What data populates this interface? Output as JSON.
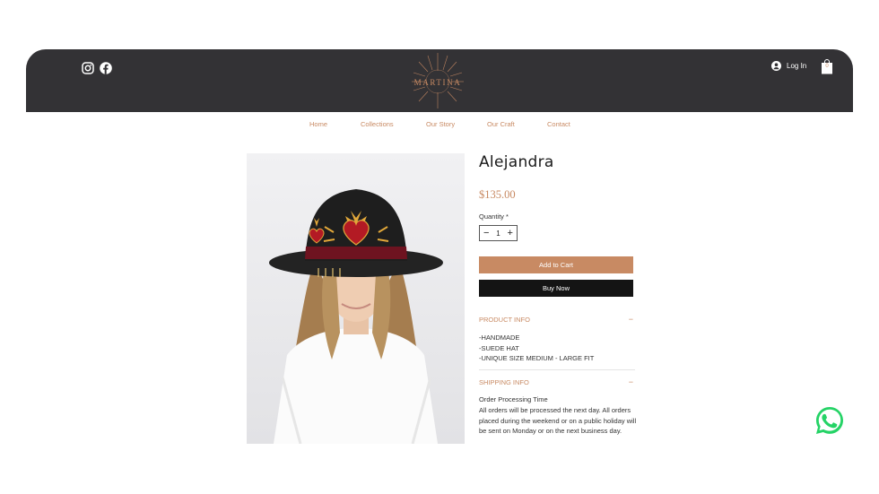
{
  "header": {
    "brand": "MARTINA",
    "login_label": "Log In",
    "cart_count": "0",
    "social_icons": [
      "instagram-icon",
      "facebook-icon"
    ]
  },
  "nav": {
    "items": [
      "Home",
      "Collections",
      "Our Story",
      "Our Craft",
      "Contact"
    ]
  },
  "product": {
    "title": "Alejandra",
    "price": "$135.00",
    "quantity_label": "Quantity *",
    "quantity_value": "1",
    "add_to_cart_label": "Add to Cart",
    "buy_now_label": "Buy Now",
    "product_info_title": "PRODUCT INFO",
    "product_info_lines": [
      "-HANDMADE",
      "-SUEDE HAT",
      "-UNIQUE SIZE MEDIUM - LARGE FIT"
    ],
    "shipping_info_title": "SHIPPING INFO",
    "shipping_lines": [
      "Order Processing Time",
      "All orders will be processed the next day. All orders placed during the weekend or on a public holiday will be sent on Monday or on the next business day."
    ]
  },
  "colors": {
    "header_bg": "#333235",
    "accent": "#c88a63",
    "buy_now_bg": "#141414",
    "whatsapp": "#25d366"
  }
}
